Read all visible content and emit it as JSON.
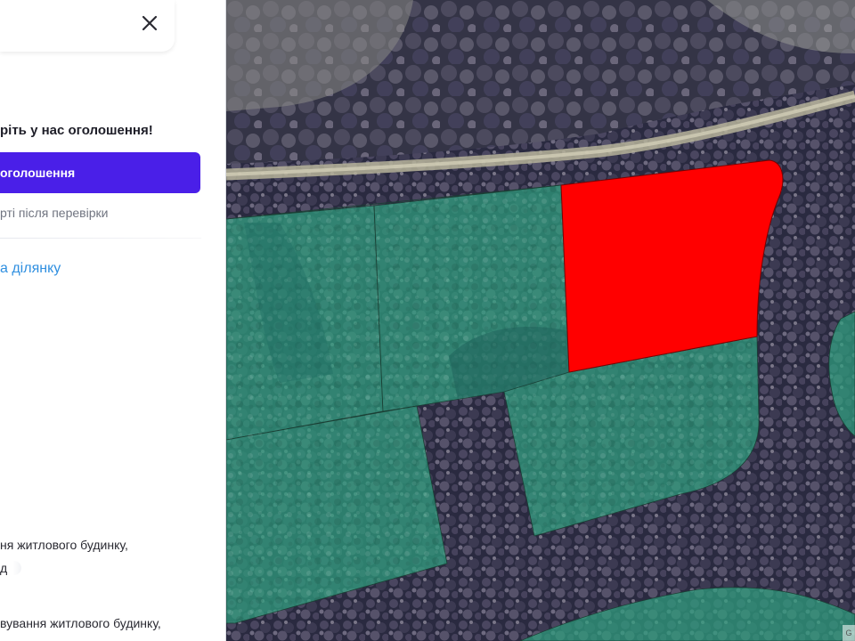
{
  "panel": {
    "promo_text": "рiть у нас оголошення!",
    "add_button_label": "оголошення",
    "hint_text": "ртi пiсля перевiрки",
    "plot_link_label": "а дiлянку",
    "purpose_lines": [
      "ня житлового будинку,",
      "д",
      "вування житлового будинку,"
    ],
    "accent_color": "#4a1fe8",
    "link_color": "#2f8fe0"
  },
  "map": {
    "layer": "satellite",
    "parcel_colors": {
      "available": "#2fa07e",
      "selected": "#ff0000"
    },
    "attribution_text": "G"
  }
}
